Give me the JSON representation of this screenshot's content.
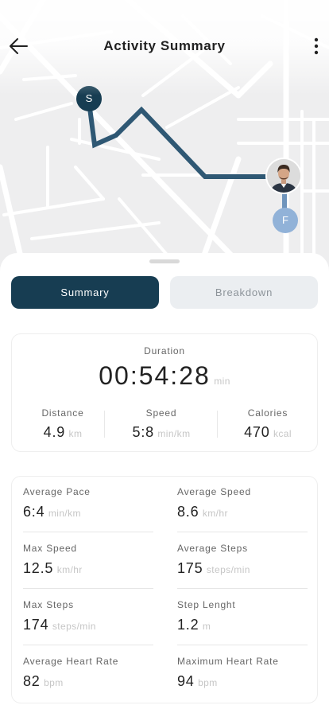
{
  "header": {
    "title": "Activity Summary",
    "back_icon": "arrow-left-icon",
    "menu_icon": "more-vertical-icon"
  },
  "map": {
    "start_marker": "S",
    "finish_marker": "F",
    "route_color": "#2f5874"
  },
  "tabs": [
    {
      "label": "Summary",
      "active": true
    },
    {
      "label": "Breakdown",
      "active": false
    }
  ],
  "duration": {
    "label": "Duration",
    "value": "00:54:28",
    "unit": "min"
  },
  "stats": [
    {
      "label": "Distance",
      "value": "4.9",
      "unit": "km"
    },
    {
      "label": "Speed",
      "value": "5:8",
      "unit": "min/km"
    },
    {
      "label": "Calories",
      "value": "470",
      "unit": "kcal"
    }
  ],
  "metrics": [
    {
      "label": "Average Pace",
      "value": "6:4",
      "unit": "min/km"
    },
    {
      "label": "Average Speed",
      "value": "8.6",
      "unit": "km/hr"
    },
    {
      "label": "Max Speed",
      "value": "12.5",
      "unit": "km/hr"
    },
    {
      "label": "Average Steps",
      "value": "175",
      "unit": "steps/min"
    },
    {
      "label": "Max Steps",
      "value": "174",
      "unit": "steps/min"
    },
    {
      "label": "Step Lenght",
      "value": "1.2",
      "unit": "m"
    },
    {
      "label": "Average Heart Rate",
      "value": "82",
      "unit": "bpm"
    },
    {
      "label": "Maximum Heart Rate",
      "value": "94",
      "unit": "bpm"
    }
  ],
  "colors": {
    "primary": "#173d52",
    "finish_marker": "#91b2d8",
    "inactive_tab": "#ebeef1"
  }
}
